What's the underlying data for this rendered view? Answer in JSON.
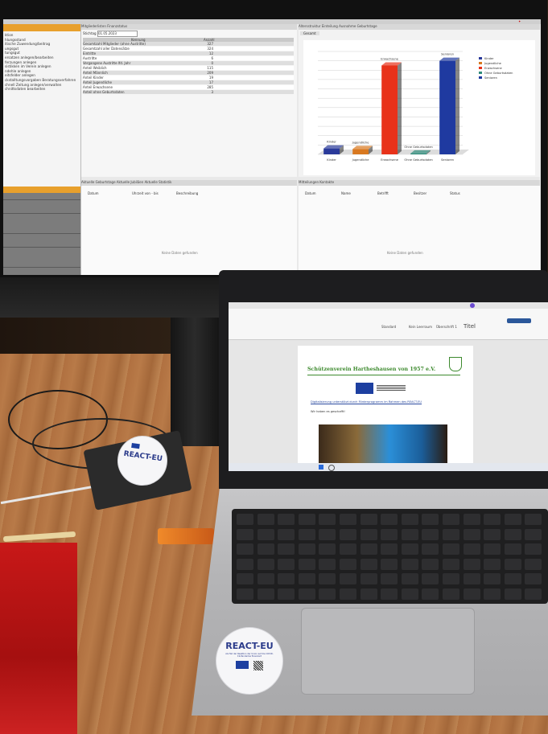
{
  "monitor": {
    "sidebar_lines": [
      "ktion",
      "hlungsstand",
      "itische Zuwendung/beitrag",
      "ungsgut",
      "tungsgut",
      "ersatzen anlegen/bearbeiten",
      "ferzungen anlegen",
      "sistikken im Verein anlegen",
      "ndehle anlegen",
      "eitsfelder anlegen",
      "ckstalltungsvorgaben Beratungsverfahren",
      "chnell Zeitung anlegen/verwalten",
      "chnittsdaten bearbeiten"
    ],
    "mid_tabs": "Mitgliederlisten   Finanzstatus",
    "stichtag_label": "Stichtag",
    "stichtag_value": "01.05.2023",
    "col_kennung": "Kennung",
    "col_anzahl": "Anzahl",
    "rows": [
      {
        "label": "Gesamtzahl Mitglieder (ohne Austritte)",
        "value": "327"
      },
      {
        "label": "Gesamtzahl aller Datensätze",
        "value": "324"
      },
      {
        "label": "Eintritte",
        "value": "12"
      },
      {
        "label": "Austritte",
        "value": "6"
      },
      {
        "label": "Vergangene Austritte lfd. Jahr",
        "value": "0"
      },
      {
        "label": "Anteil Weiblich",
        "value": "115"
      },
      {
        "label": "Anteil Männlich",
        "value": "209"
      },
      {
        "label": "Anteil Kinder",
        "value": "19"
      },
      {
        "label": "Anteil Jugendliche",
        "value": "17"
      },
      {
        "label": "Anteil Erwachsene",
        "value": "285"
      },
      {
        "label": "Anteil ohne Geburtsdaten",
        "value": "3"
      }
    ],
    "chart_tabs": "Altersstruktur   Einteilung Ausnahme   Geburtstage",
    "chart_subtab": "Gesamt",
    "low_tabs_left": "Aktuelle Geburtstage   Aktuelle Jubiläen   Aktuelle Statistik",
    "low_cols_left": [
      "Datum",
      "Uhrzeit von - bis",
      "Beschreibung"
    ],
    "empty_left": "Keine Daten gefunden",
    "low_tabs_right": "Mitteilungen   Kontakte",
    "low_cols_right": [
      "Datum",
      "Name",
      "Betrifft",
      "Besitzer",
      "Status"
    ],
    "empty_right": "Keine Daten gefunden"
  },
  "chart_data": {
    "type": "bar",
    "categories": [
      "Kinder",
      "Jugendliche",
      "Erwachsene",
      "Ohne Geburtsdaten",
      "Senioren"
    ],
    "values": [
      19,
      17,
      285,
      3,
      300
    ],
    "ylim": [
      0,
      330
    ],
    "colors": [
      "#2a3a9a",
      "#d8781f",
      "#e8321a",
      "#2e8c7a",
      "#1f3aa0"
    ],
    "legend": [
      "Kinder",
      "Jugendliche",
      "Erwachsene",
      "Ohne Geburtsdaten",
      "Senioren"
    ],
    "legend_position": "right",
    "grid": true,
    "style": "3d"
  },
  "laptop": {
    "doc_heading": "Schützenverein Hartheshausen von 1957 e.V.",
    "doc_line1": "Digitalisierung unterstützt durch Förderprogramm im Rahmen des REACT-EU",
    "doc_line2": "Wir haben es geschafft!",
    "ribbon_styles": [
      "Standard",
      "Kein Leerraum",
      "Überschrift 1",
      "Titel"
    ]
  },
  "stickers": {
    "small": "REACT-EU",
    "large": "REACT-EU",
    "large_sub": "Als Teil der Reaktion der Union auf die COVID-19-Pandemie finanziert"
  },
  "colors": {
    "accent_orange": "#e8a02c",
    "desk": "#b07a45",
    "word_blue": "#2b579a"
  }
}
